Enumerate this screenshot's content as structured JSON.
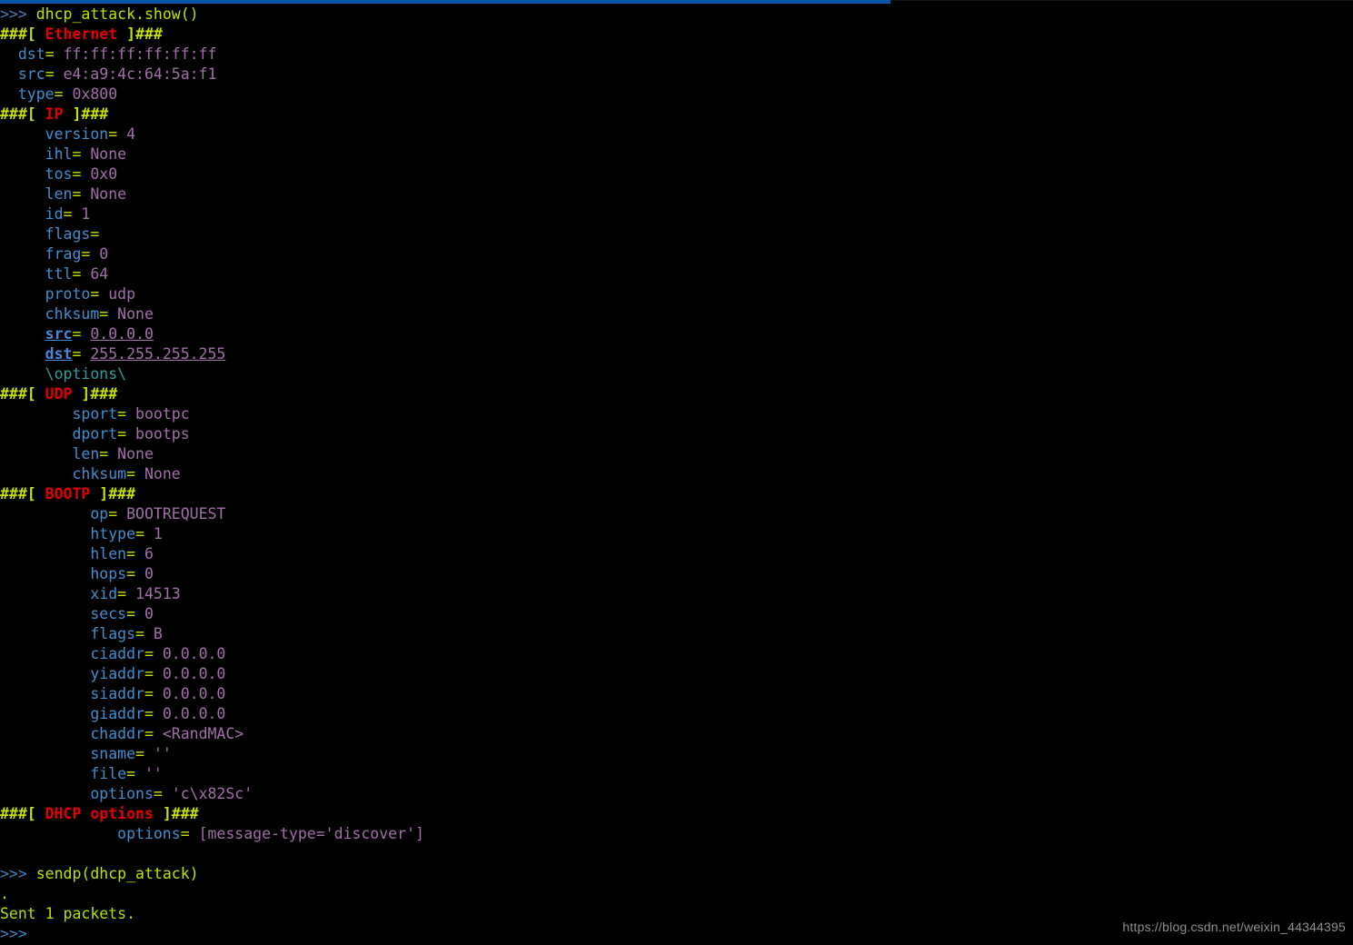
{
  "window": {
    "accent_color": "#0b57ad",
    "background_color": "#000000"
  },
  "theme": {
    "prompt_color": "#3f7fbf",
    "command_color": "#c0e000",
    "header_mark_color": "#c8e000",
    "layer_name_color": "#e00000",
    "field_name_color": "#3f8fd0",
    "equals_color": "#c8e000",
    "value_color": "#a06fa8",
    "payload_color": "#2f9e9e"
  },
  "session": {
    "prompt": ">>>",
    "command_show": "dhcp_attack.show()",
    "command_sendp": "sendp(dhcp_attack)",
    "send_dot": ".",
    "send_result": "Sent 1 packets.",
    "trailing_prompt": ">>>"
  },
  "packet": {
    "layers": [
      {
        "name": "Ethernet",
        "open_mark": "###[ ",
        "close_mark": " ]###",
        "indent": "  ",
        "fields": [
          {
            "name": "dst",
            "eq": "=",
            "value": "ff:ff:ff:ff:ff:ff"
          },
          {
            "name": "src",
            "eq": "=",
            "value": "e4:a9:4c:64:5a:f1"
          },
          {
            "name": "type",
            "eq": "=",
            "value": "0x800"
          }
        ]
      },
      {
        "name": "IP",
        "open_mark": "###[ ",
        "close_mark": " ]###",
        "indent": "     ",
        "fields": [
          {
            "name": "version",
            "eq": "=",
            "value": "4"
          },
          {
            "name": "ihl",
            "eq": "=",
            "value": "None"
          },
          {
            "name": "tos",
            "eq": "=",
            "value": "0x0"
          },
          {
            "name": "len",
            "eq": "=",
            "value": "None"
          },
          {
            "name": "id",
            "eq": "=",
            "value": "1"
          },
          {
            "name": "flags",
            "eq": "=",
            "value": ""
          },
          {
            "name": "frag",
            "eq": "=",
            "value": "0"
          },
          {
            "name": "ttl",
            "eq": "=",
            "value": "64"
          },
          {
            "name": "proto",
            "eq": "=",
            "value": "udp"
          },
          {
            "name": "chksum",
            "eq": "=",
            "value": "None"
          },
          {
            "name": "src",
            "eq": "=",
            "value": "0.0.0.0",
            "emphasis": "underline"
          },
          {
            "name": "dst",
            "eq": "=",
            "value": "255.255.255.255",
            "emphasis": "underline"
          }
        ],
        "payload_marker": "\\options\\"
      },
      {
        "name": "UDP",
        "open_mark": "###[ ",
        "close_mark": " ]###",
        "indent": "        ",
        "fields": [
          {
            "name": "sport",
            "eq": "=",
            "value": "bootpc"
          },
          {
            "name": "dport",
            "eq": "=",
            "value": "bootps"
          },
          {
            "name": "len",
            "eq": "=",
            "value": "None"
          },
          {
            "name": "chksum",
            "eq": "=",
            "value": "None"
          }
        ]
      },
      {
        "name": "BOOTP",
        "open_mark": "###[ ",
        "close_mark": " ]###",
        "indent": "          ",
        "fields": [
          {
            "name": "op",
            "eq": "=",
            "value": "BOOTREQUEST"
          },
          {
            "name": "htype",
            "eq": "=",
            "value": "1"
          },
          {
            "name": "hlen",
            "eq": "=",
            "value": "6"
          },
          {
            "name": "hops",
            "eq": "=",
            "value": "0"
          },
          {
            "name": "xid",
            "eq": "=",
            "value": "14513"
          },
          {
            "name": "secs",
            "eq": "=",
            "value": "0"
          },
          {
            "name": "flags",
            "eq": "=",
            "value": "B"
          },
          {
            "name": "ciaddr",
            "eq": "=",
            "value": "0.0.0.0"
          },
          {
            "name": "yiaddr",
            "eq": "=",
            "value": "0.0.0.0"
          },
          {
            "name": "siaddr",
            "eq": "=",
            "value": "0.0.0.0"
          },
          {
            "name": "giaddr",
            "eq": "=",
            "value": "0.0.0.0"
          },
          {
            "name": "chaddr",
            "eq": "=",
            "value": "<RandMAC>"
          },
          {
            "name": "sname",
            "eq": "=",
            "value": "''"
          },
          {
            "name": "file",
            "eq": "=",
            "value": "''"
          },
          {
            "name": "options",
            "eq": "=",
            "value": "'c\\x82Sc'"
          }
        ]
      },
      {
        "name": "DHCP options",
        "open_mark": "###[ ",
        "close_mark": " ]###",
        "indent": "             ",
        "fields": [
          {
            "name": "options",
            "eq": "=",
            "value": "[message-type='discover']"
          }
        ]
      }
    ]
  },
  "watermark": {
    "text": "https://blog.csdn.net/weixin_44344395"
  }
}
